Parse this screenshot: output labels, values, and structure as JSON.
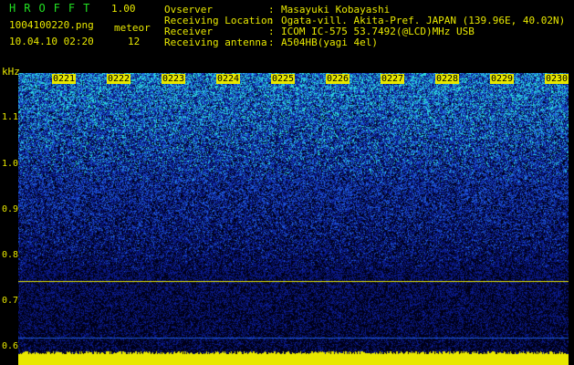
{
  "header": {
    "app_title": "HROFFT",
    "app_version": "1.00",
    "file_name": "1004100220.png",
    "meteor_label": "meteor",
    "date_time": "10.04.10 02:20",
    "meteor_count": "12"
  },
  "info": [
    {
      "key": "Ovserver",
      "value": "Masayuki Kobayashi"
    },
    {
      "key": "Receiving Location",
      "value": "Ogata-vill. Akita-Pref. JAPAN (139.96E, 40.02N)"
    },
    {
      "key": "Receiver",
      "value": "ICOM IC-575 53.7492(@LCD)MHz USB"
    },
    {
      "key": "Receiving antenna",
      "value": "A504HB(yagi 4el)"
    }
  ],
  "spectrogram": {
    "unit_label": "kHz",
    "y_ticks": [
      "1.1",
      "1.0",
      "0.9",
      "0.8",
      "0.7",
      "0.6"
    ],
    "x_ticks": [
      "0221",
      "0222",
      "0223",
      "0224",
      "0225",
      "0226",
      "0227",
      "0228",
      "0229",
      "0230"
    ],
    "colors": {
      "background": "#000018",
      "noise_low": "#0a1a8a",
      "noise_mid": "#1e5ad8",
      "noise_high": "#2adada",
      "signal": "#e8e800"
    }
  }
}
